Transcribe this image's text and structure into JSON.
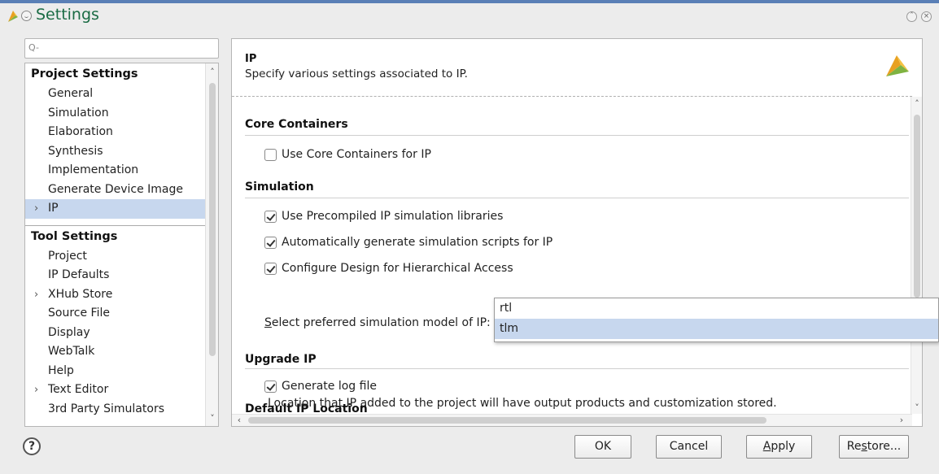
{
  "window": {
    "title": "Settings"
  },
  "search": {
    "placeholder": "Q-"
  },
  "nav": {
    "groups": [
      {
        "label": "Project Settings",
        "items": [
          "General",
          "Simulation",
          "Elaboration",
          "Synthesis",
          "Implementation",
          "Generate Device Image",
          "IP"
        ]
      },
      {
        "label": "Tool Settings",
        "items": [
          "Project",
          "IP Defaults",
          "XHub Store",
          "Source File",
          "Display",
          "WebTalk",
          "Help",
          "Text Editor",
          "3rd Party Simulators"
        ]
      }
    ],
    "selected": "IP"
  },
  "panel": {
    "heading": "IP",
    "description": "Specify various settings associated to IP.",
    "sections": {
      "core_containers": {
        "title": "Core Containers",
        "use_core_containers": {
          "label": "Use Core Containers for IP",
          "checked": false
        }
      },
      "simulation": {
        "title": "Simulation",
        "precompiled": {
          "label": "Use Precompiled IP simulation libraries",
          "checked": true
        },
        "auto_scripts": {
          "label": "Automatically generate simulation scripts for IP",
          "checked": true
        },
        "hierarchical": {
          "label": "Configure Design for Hierarchical Access",
          "checked": true
        },
        "model_label_accesskey": "S",
        "model_label_rest": "elect preferred simulation model of IP:",
        "model_value": "tlm",
        "model_options": [
          "rtl",
          "tlm"
        ]
      },
      "upgrade_ip": {
        "title": "Upgrade IP",
        "log_file": {
          "label": "Generate log file",
          "checked": true
        }
      },
      "default_ip_location": {
        "title": "Default IP Location",
        "text": "Location that IP added to the project will have output products and customization stored."
      }
    }
  },
  "buttons": {
    "help": "?",
    "ok": "OK",
    "cancel": "Cancel",
    "apply_key": "A",
    "apply_rest": "pply",
    "restore_pre": "Re",
    "restore_key": "s",
    "restore_rest": "tore..."
  },
  "colors": {
    "title": "#1a6b44",
    "selection": "#c7d7ee",
    "focus_border": "#5a86c9"
  }
}
